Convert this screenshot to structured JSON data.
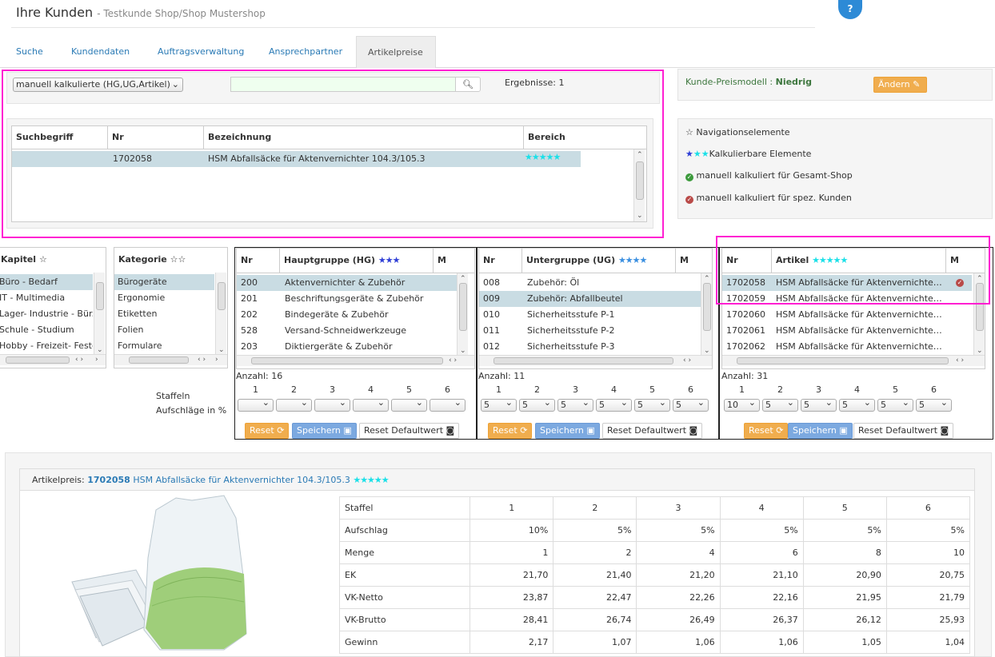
{
  "header": {
    "title": "Ihre Kunden",
    "subtitle": "- Testkunde Shop/Shop Mustershop",
    "help": "?"
  },
  "tabs": [
    "Suche",
    "Kundendaten",
    "Auftragsverwaltung",
    "Ansprechpartner",
    "Artikelpreise"
  ],
  "search": {
    "select_value": "manuell kalkulierte (HG,UG,Artikel)",
    "input_value": "",
    "results": "Ergebnisse: 1",
    "columns": [
      "Suchbegriff",
      "Nr",
      "Bezeichnung",
      "Bereich"
    ],
    "row": {
      "suchbegriff": "",
      "nr": "1702058",
      "bezeichnung": "HSM Abfallsäcke für Aktenvernichter 104.3/105.3",
      "bereich_stars": "★★★★★"
    }
  },
  "price_model": {
    "label": "Kunde-Preismodell :",
    "value": "Niedrig",
    "button": "Ändern"
  },
  "legend": {
    "nav": "Navigationselemente",
    "calc": "Kalkulierbare Elemente",
    "shop": "manuell kalkuliert für Gesamt-Shop",
    "cust": "manuell kalkuliert für spez. Kunden"
  },
  "kapitel": {
    "header": "Kapitel",
    "items": [
      "Büro - Bedarf",
      "IT - Multimedia",
      "Lager- Industrie - Bür.",
      "Schule - Studium",
      "Hobby - Freizeit- Feste"
    ]
  },
  "kategorie": {
    "header": "Kategorie",
    "items": [
      "Bürogeräte",
      "Ergonomie",
      "Etiketten",
      "Folien",
      "Formulare"
    ]
  },
  "hg": {
    "nr": "Nr",
    "header": "Hauptgruppe (HG)",
    "m": "M",
    "rows": [
      [
        "200",
        "Aktenvernichter & Zubehör"
      ],
      [
        "201",
        "Beschriftungsgeräte & Zubehör"
      ],
      [
        "202",
        "Bindegeräte & Zubehör"
      ],
      [
        "528",
        "Versand-Schneidwerkzeuge"
      ],
      [
        "203",
        "Diktiergeräte & Zubehör"
      ]
    ],
    "count": "Anzahl: 16",
    "values": [
      "",
      "",
      "",
      "",
      "",
      ""
    ]
  },
  "ug": {
    "nr": "Nr",
    "header": "Untergruppe (UG)",
    "m": "M",
    "rows": [
      [
        "008",
        "Zubehör: Öl"
      ],
      [
        "009",
        "Zubehör: Abfallbeutel"
      ],
      [
        "010",
        "Sicherheitsstufe P-1"
      ],
      [
        "011",
        "Sicherheitsstufe P-2"
      ],
      [
        "012",
        "Sicherheitsstufe P-3"
      ]
    ],
    "count": "Anzahl: 11",
    "values": [
      "5",
      "5",
      "5",
      "5",
      "5",
      "5"
    ]
  },
  "art": {
    "nr": "Nr",
    "header": "Artikel",
    "m": "M",
    "rows": [
      [
        "1702058",
        "HSM Abfallsäcke für Aktenvernichte…"
      ],
      [
        "1702059",
        "HSM Abfallsäcke für Aktenvernichte…"
      ],
      [
        "1702060",
        "HSM Abfallsäcke für Aktenvernichte…"
      ],
      [
        "1702061",
        "HSM Abfallsäcke für Aktenvernichte…"
      ],
      [
        "1702062",
        "HSM Abfallsäcke für Aktenvernichte…"
      ]
    ],
    "count": "Anzahl: 31",
    "values": [
      "10",
      "5",
      "5",
      "5",
      "5",
      "5"
    ]
  },
  "staffel_numbers": [
    "1",
    "2",
    "3",
    "4",
    "5",
    "6"
  ],
  "staffeln_label": "Staffeln",
  "aufschlaege_label": "Aufschläge in %",
  "buttons": {
    "reset": "Reset",
    "save": "Speichern",
    "reset_default": "Reset Defaultwert"
  },
  "articleprice": {
    "label": "Artikelpreis:",
    "nr": "1702058",
    "name": "HSM Abfallsäcke für Aktenvernichter 104.3/105.3",
    "rows": [
      [
        "Staffel",
        "1",
        "2",
        "3",
        "4",
        "5",
        "6"
      ],
      [
        "Aufschlag",
        "10%",
        "5%",
        "5%",
        "5%",
        "5%",
        "5%"
      ],
      [
        "Menge",
        "1",
        "2",
        "4",
        "6",
        "8",
        "10"
      ],
      [
        "EK",
        "21,70",
        "21,40",
        "21,20",
        "21,10",
        "20,90",
        "20,75"
      ],
      [
        "VK-Netto",
        "23,87",
        "22,47",
        "22,26",
        "22,16",
        "21,95",
        "21,79"
      ],
      [
        "VK-Brutto",
        "28,41",
        "26,74",
        "26,49",
        "26,37",
        "26,12",
        "25,93"
      ],
      [
        "Gewinn",
        "2,17",
        "1,07",
        "1,06",
        "1,06",
        "1,05",
        "1,04"
      ]
    ]
  },
  "colors": {
    "pink": "#ff1fd2",
    "orange": "#f0ad4e",
    "blue": "#5bc0de",
    "link": "#2a7ab5",
    "green": "#3c763d"
  }
}
